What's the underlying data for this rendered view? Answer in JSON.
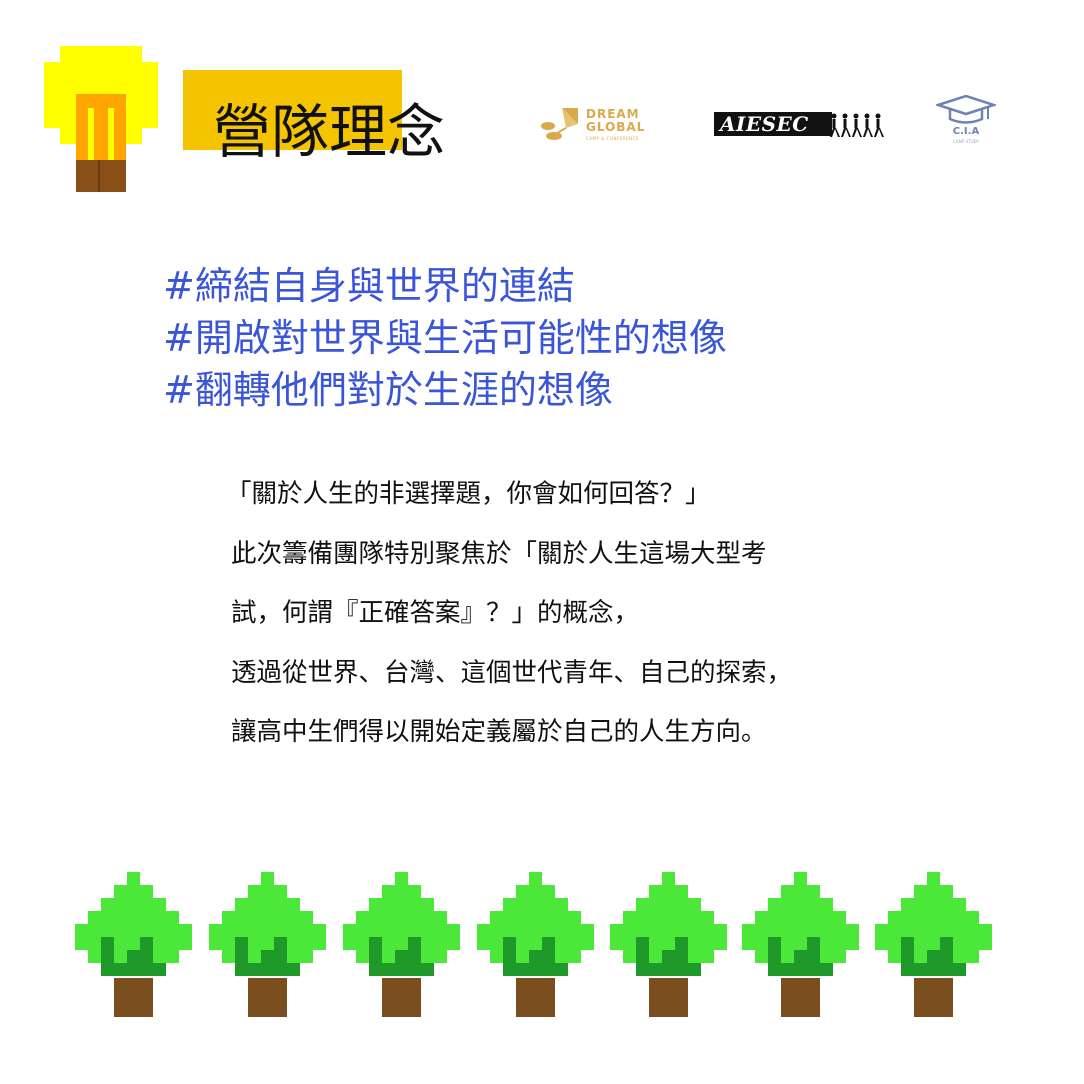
{
  "header": {
    "title": "營隊理念",
    "highlight_color": "#f5c400"
  },
  "logos": {
    "dream_global": {
      "line1": "DREAM",
      "line2": "GLOBAL",
      "tagline": "CAMP & CONFERENCE",
      "icon": "kite-icon",
      "color": "#d9a94a"
    },
    "aiesec": {
      "text": "AIESEC",
      "icon": "walking-people-icon"
    },
    "cia": {
      "text": "C.I.A",
      "tagline": "CAMP STUDY",
      "icon": "graduation-cap-icon",
      "color": "#6e82b6"
    }
  },
  "hashtags": [
    "#締結自身與世界的連結",
    "#開啟對世界與生活可能性的想像",
    "#翻轉他們對於生涯的想像"
  ],
  "hashtag_color": "#3b55d8",
  "body": {
    "lines": [
      "「關於人生的非選擇題，你會如何回答？」",
      "此次籌備團隊特別聚焦於「關於人生這場大型考",
      "試，何謂『正確答案』？」的概念，",
      "透過從世界、台灣、這個世代青年、自己的探索，",
      "讓高中生們得以開始定義屬於自己的人生方向。"
    ]
  },
  "decor": {
    "bulb_icon": "pixel-lightbulb-icon",
    "tree_icon": "pixel-tree-icon",
    "tree_count": 7,
    "colors": {
      "leaf_light": "#4be83a",
      "leaf_dark": "#1f9a2a",
      "trunk": "#7a4e1e",
      "bulb_yellow": "#ffff00",
      "bulb_orange": "#ffa500"
    }
  }
}
